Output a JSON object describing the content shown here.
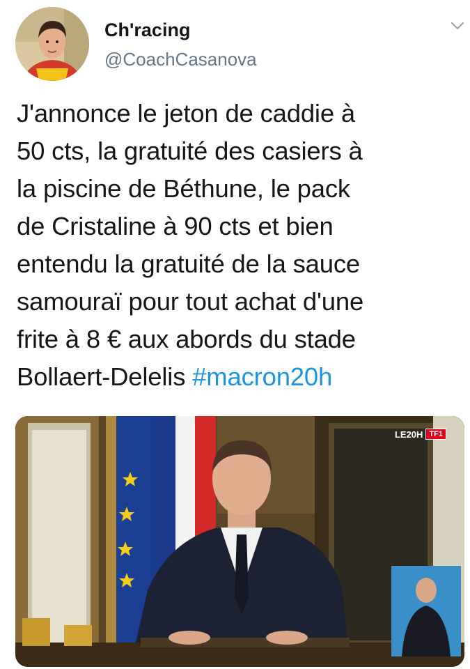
{
  "tweet": {
    "author": {
      "display_name": "Ch'racing",
      "handle": "@CoachCasanova"
    },
    "text_lines": [
      "J'annonce le jeton de caddie à",
      "50 cts, la gratuité des casiers à",
      "la piscine de Béthune, le pack",
      "de Cristaline à 90 cts et bien",
      "entendu la gratuité de la sauce",
      "samouraï pour tout achat d'une",
      "frite à 8 € aux abords du stade",
      "Bollaert-Delelis "
    ],
    "hashtag": "#macron20h",
    "media": {
      "logo_text": "LE20H",
      "logo_channel": "TF1"
    }
  },
  "colors": {
    "hashtag": "#1b95e0",
    "handle": "#657786",
    "text": "#14171a"
  },
  "icons": {
    "menu": "chevron-down-icon"
  }
}
